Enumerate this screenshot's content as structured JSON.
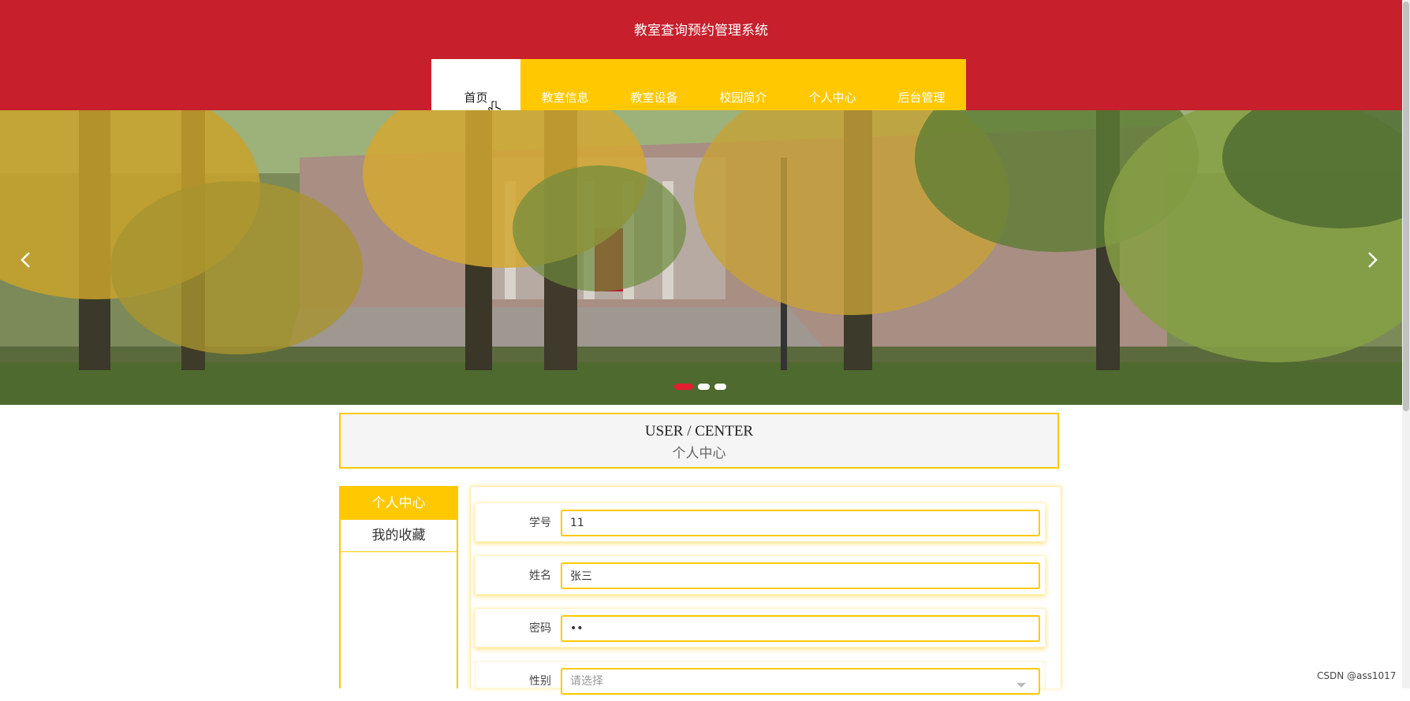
{
  "header": {
    "title": "教室查询预约管理系统"
  },
  "nav": {
    "items": [
      {
        "label": "首页",
        "active": true
      },
      {
        "label": "教室信息",
        "active": false
      },
      {
        "label": "教室设备",
        "active": false
      },
      {
        "label": "校园简介",
        "active": false
      },
      {
        "label": "个人中心",
        "active": false
      },
      {
        "label": "后台管理",
        "active": false
      }
    ]
  },
  "carousel": {
    "prev_icon": "chevron-left-icon",
    "next_icon": "chevron-right-icon",
    "slide_count": 3,
    "active_index": 0
  },
  "section": {
    "title_en": "USER / CENTER",
    "title_cn": "个人中心"
  },
  "sidebar": {
    "items": [
      {
        "label": "个人中心",
        "active": true
      },
      {
        "label": "我的收藏",
        "active": false
      }
    ]
  },
  "form": {
    "student_id": {
      "label": "学号",
      "value": "11"
    },
    "name": {
      "label": "姓名",
      "value": "张三"
    },
    "password": {
      "label": "密码",
      "value": "••"
    },
    "gender": {
      "label": "性别",
      "placeholder": "请选择"
    }
  },
  "watermark": "CSDN @ass1017",
  "colors": {
    "header": "#c81f2c",
    "accent": "#ffc800",
    "dot_active": "#e02030"
  }
}
